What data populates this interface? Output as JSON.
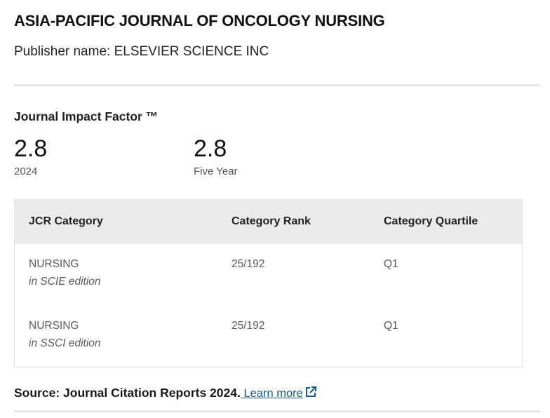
{
  "journal": {
    "title": "ASIA-PACIFIC JOURNAL OF ONCOLOGY NURSING",
    "publisher": "Publisher name: ELSEVIER SCIENCE INC"
  },
  "impact_factor": {
    "heading": "Journal Impact Factor ™",
    "metrics": [
      {
        "value": "2.8",
        "label": "2024"
      },
      {
        "value": "2.8",
        "label": "Five Year"
      }
    ]
  },
  "category_table": {
    "headers": [
      "JCR Category",
      "Category Rank",
      "Category Quartile"
    ],
    "rows": [
      {
        "category": "NURSING",
        "edition": "in SCIE edition",
        "rank": "25/192",
        "quartile": "Q1"
      },
      {
        "category": "NURSING",
        "edition": "in SSCI edition",
        "rank": "25/192",
        "quartile": "Q1"
      }
    ]
  },
  "source": {
    "text": "Source: Journal Citation Reports  2024.",
    "link_label": " Learn more",
    "icon": "external-link-icon",
    "link_color": "#1a5a8a"
  }
}
